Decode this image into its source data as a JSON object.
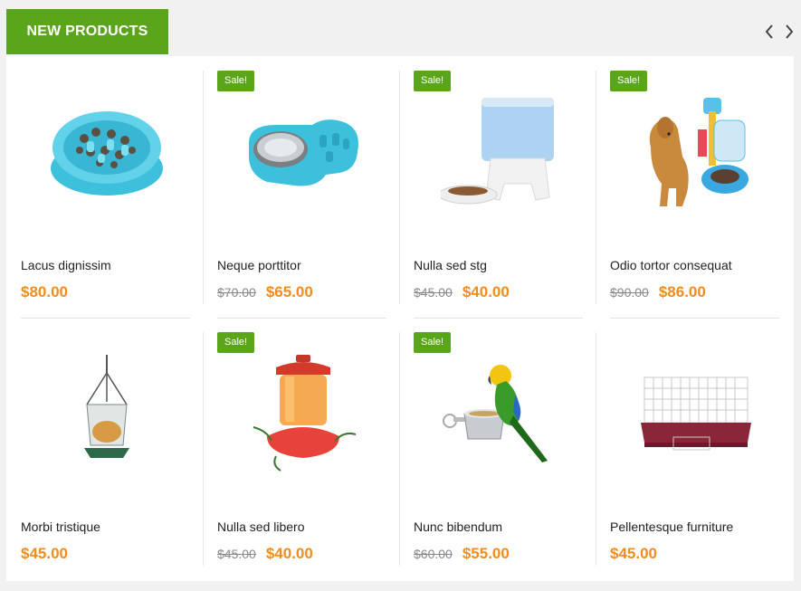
{
  "header": {
    "tab_label": "NEW PRODUCTS",
    "prev_icon": "chevron-left-icon",
    "next_icon": "chevron-right-icon"
  },
  "colors": {
    "brand": "#5aa51a",
    "price": "#f28c1c",
    "old_price": "#888888"
  },
  "products": [
    {
      "name": "Lacus dignissim",
      "sale": "",
      "old_price": "",
      "price": "$80.00",
      "image": "slow-feeder-bowl"
    },
    {
      "name": "Neque porttitor",
      "sale": "Sale!",
      "old_price": "$70.00",
      "price": "$65.00",
      "image": "pet-bowl-with-steel-dish"
    },
    {
      "name": "Nulla sed stg",
      "sale": "Sale!",
      "old_price": "$45.00",
      "price": "$40.00",
      "image": "automatic-pet-feeder"
    },
    {
      "name": "Odio tortor consequat",
      "sale": "Sale!",
      "old_price": "$90.00",
      "price": "$86.00",
      "image": "dog-with-water-dispenser"
    },
    {
      "name": "Morbi tristique",
      "sale": "",
      "old_price": "",
      "price": "$45.00",
      "image": "hanging-bird-feeder"
    },
    {
      "name": "Nulla sed libero",
      "sale": "Sale!",
      "old_price": "$45.00",
      "price": "$40.00",
      "image": "hummingbird-feeder"
    },
    {
      "name": "Nunc bibendum",
      "sale": "Sale!",
      "old_price": "$60.00",
      "price": "$55.00",
      "image": "parrot-on-bowl"
    },
    {
      "name": "Pellentesque furniture",
      "sale": "",
      "old_price": "",
      "price": "$45.00",
      "image": "small-animal-cage"
    }
  ]
}
